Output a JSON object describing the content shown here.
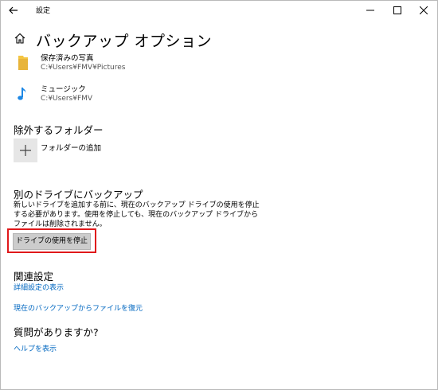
{
  "window": {
    "title": "設定"
  },
  "header": {
    "title": "バックアップ オプション"
  },
  "folders": [
    {
      "name": "保存済みの写真",
      "path": "C:¥Users¥FMV¥Pictures",
      "icon": "folder-icon"
    },
    {
      "name": "ミュージック",
      "path": "C:¥Users¥FMV",
      "icon": "music-note-icon"
    }
  ],
  "exclude": {
    "heading": "除外するフォルダー",
    "add_label": "フォルダーの追加"
  },
  "other_drive": {
    "heading": "別のドライブにバックアップ",
    "description": "新しいドライブを追加する前に、現在のバックアップ ドライブの使用を停止する必要があります。使用を停止しても、現在のバックアップ ドライブからファイルは削除されません。",
    "stop_button": "ドライブの使用を停止"
  },
  "related": {
    "heading": "関連設定",
    "link_advanced": "詳細設定の表示",
    "link_restore": "現在のバックアップからファイルを復元"
  },
  "question": {
    "heading": "質問がありますか?",
    "link_help": "ヘルプを表示"
  },
  "colors": {
    "link": "#0067c0",
    "highlight": "#e0191b",
    "folder": "#f4c542",
    "music": "#1e88e5"
  }
}
